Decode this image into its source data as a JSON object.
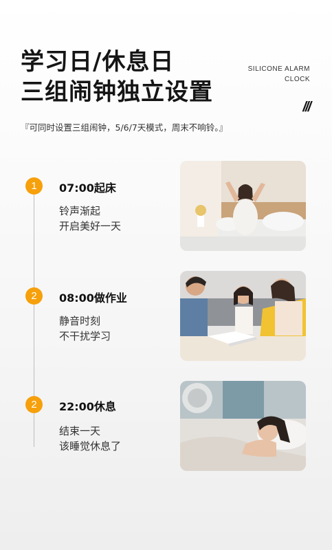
{
  "header": {
    "title_line1": "学习日/休息日",
    "title_line2": "三组闹钟独立设置",
    "brand_line1": "SILICONE ALARM",
    "brand_line2": "CLOCK",
    "slashes": "///",
    "subtitle": "『可同时设置三组闹钟，5/6/7天模式，周末不响铃。』"
  },
  "accent_color": "#f6a00c",
  "schedule": [
    {
      "badge": "1",
      "time": "07:00起床",
      "desc_line1": "铃声渐起",
      "desc_line2": "开启美好一天"
    },
    {
      "badge": "2",
      "time": "08:00做作业",
      "desc_line1": "静音时刻",
      "desc_line2": "不干扰学习"
    },
    {
      "badge": "2",
      "time": "22:00休息",
      "desc_line1": "结束一天",
      "desc_line2": "该睡觉休息了"
    }
  ]
}
